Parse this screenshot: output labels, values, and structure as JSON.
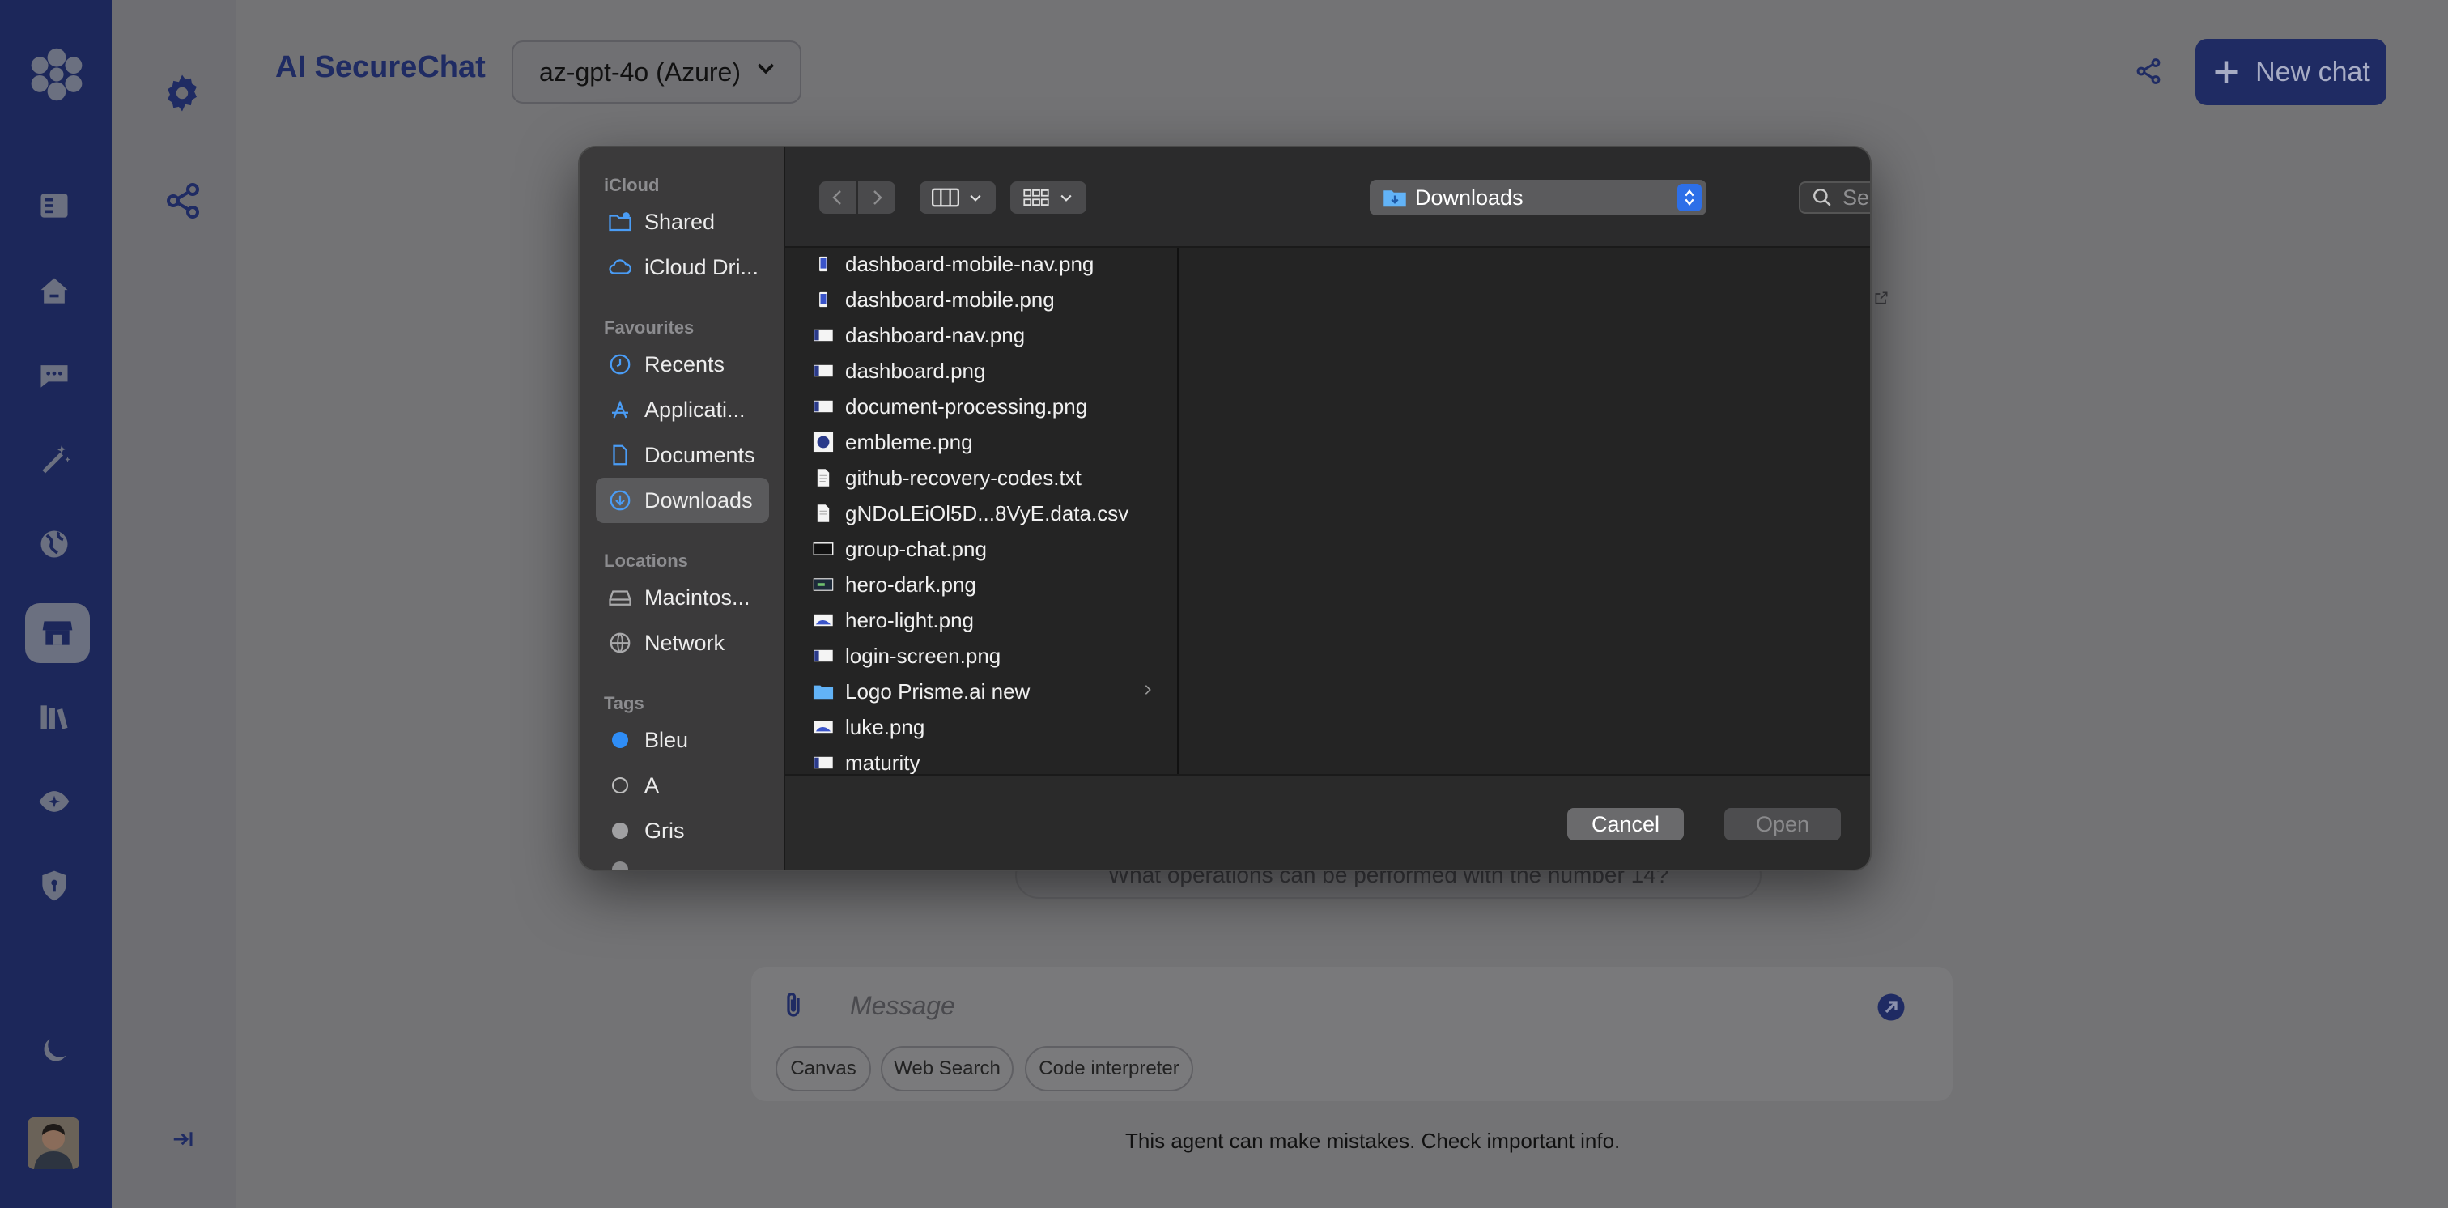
{
  "app": {
    "title": "AI SecureChat",
    "model_selected": "az-gpt-4o (Azure)",
    "new_chat_label": "New chat",
    "suggestion": "What operations can be performed with the number 14?",
    "message_placeholder": "Message",
    "chips": [
      "Canvas",
      "Web Search",
      "Code interpreter"
    ],
    "disclaimer": "This agent can make mistakes. Check important info."
  },
  "rail": {
    "icons": [
      "logo-icon",
      "sidebar-icon",
      "home-icon",
      "chat-icon",
      "magic-wand-icon",
      "globe-icon",
      "store-icon",
      "library-icon",
      "eye-icon",
      "shield-icon",
      "moon-icon",
      "avatar"
    ],
    "active": "store-icon"
  },
  "secondary": {
    "icons": [
      "settings-icon",
      "share-icon",
      "collapse-icon"
    ]
  },
  "dialog": {
    "sidebar": {
      "icloud_header": "iCloud",
      "icloud_items": [
        "Shared",
        "iCloud Dri..."
      ],
      "favourites_header": "Favourites",
      "favourites_items": [
        "Recents",
        "Applicati...",
        "Documents",
        "Downloads"
      ],
      "selected": "Downloads",
      "locations_header": "Locations",
      "locations_items": [
        "Macintos...",
        "Network"
      ],
      "tags_header": "Tags",
      "tags": [
        {
          "label": "Bleu",
          "color": "#2f8df6"
        },
        {
          "label": "A",
          "color": "none"
        },
        {
          "label": "Gris",
          "color": "#a0a0a2"
        }
      ]
    },
    "location": "Downloads",
    "search_placeholder": "Search",
    "files": [
      {
        "name": "dashboard-mobile-nav.png",
        "kind": "image-mobile"
      },
      {
        "name": "dashboard-mobile.png",
        "kind": "image-mobile"
      },
      {
        "name": "dashboard-nav.png",
        "kind": "image"
      },
      {
        "name": "dashboard.png",
        "kind": "image"
      },
      {
        "name": "document-processing.png",
        "kind": "image"
      },
      {
        "name": "embleme.png",
        "kind": "image-emblem"
      },
      {
        "name": "github-recovery-codes.txt",
        "kind": "text"
      },
      {
        "name": "gNDoLEiOl5D...8VyE.data.csv",
        "kind": "text"
      },
      {
        "name": "group-chat.png",
        "kind": "image-blank"
      },
      {
        "name": "hero-dark.png",
        "kind": "image-dark"
      },
      {
        "name": "hero-light.png",
        "kind": "image-light"
      },
      {
        "name": "login-screen.png",
        "kind": "image"
      },
      {
        "name": "Logo Prisme.ai new",
        "kind": "folder"
      },
      {
        "name": "luke.png",
        "kind": "image-light"
      },
      {
        "name": "maturity",
        "kind": "image"
      }
    ],
    "cancel_label": "Cancel",
    "open_label": "Open"
  },
  "colors": {
    "rail_bg": "#1c275a",
    "accent": "#1f2b63",
    "dialog_bg": "#242424",
    "mac_blue": "#2d6fe8",
    "sidebar_icon_blue": "#4a9cf5"
  }
}
